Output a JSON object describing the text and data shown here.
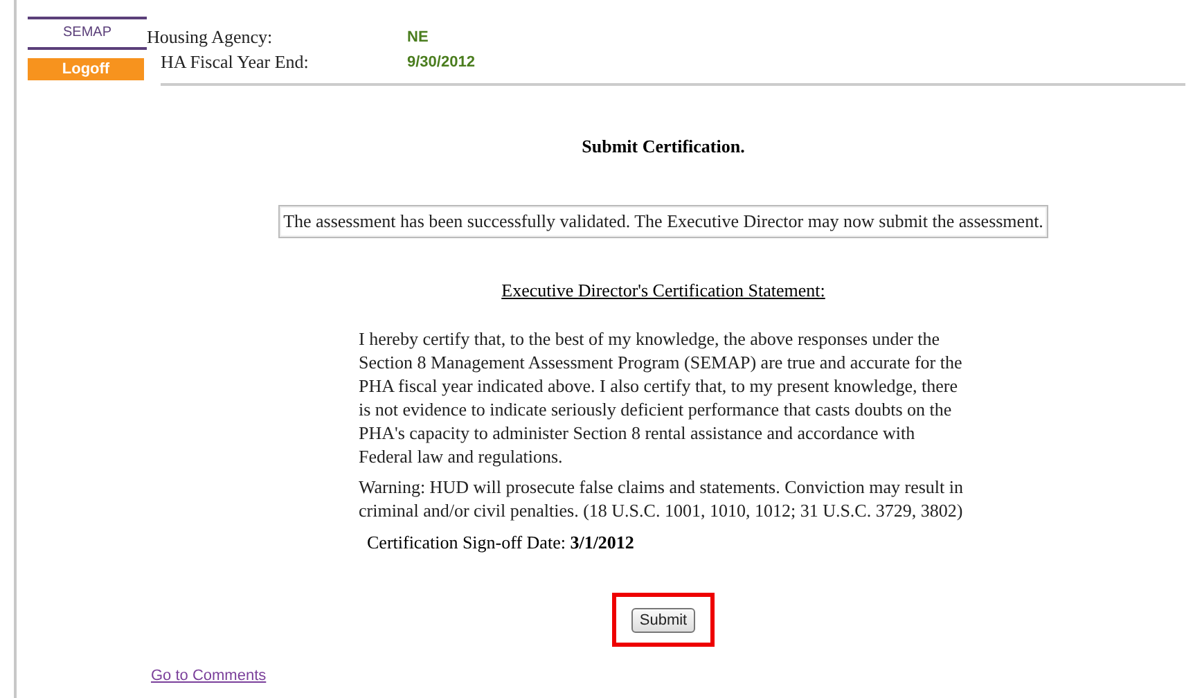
{
  "sidebar": {
    "items": [
      {
        "label": "SEMAP",
        "kind": "tab"
      },
      {
        "label": "Logoff",
        "kind": "button"
      }
    ]
  },
  "header_fields": [
    {
      "label": "Housing Agency:",
      "value": "NE"
    },
    {
      "label": "HA Fiscal Year End:",
      "value": "9/30/2012"
    }
  ],
  "title": "Submit Certification.",
  "message": "The assessment has been successfully validated. The Executive Director may now submit the assessment.",
  "statement": {
    "heading": "Executive Director's Certification Statement:",
    "paragraphs": [
      "I hereby certify that, to the best of my knowledge, the above responses under the Section 8 Management Assessment Program (SEMAP) are true and accurate for the PHA fiscal year indicated above. I also certify that, to my present knowledge, there is not evidence to indicate seriously deficient performance that casts doubts on the PHA's capacity to administer Section 8 rental assistance and accordance with Federal law and regulations.",
      "Warning: HUD will prosecute false claims and statements. Conviction may result in criminal and/or civil penalties. (18 U.S.C. 1001, 1010, 1012; 31 U.S.C. 3729, 3802)"
    ],
    "signoff_label": "Certification Sign-off Date:",
    "signoff_date": "3/1/2012"
  },
  "submit_button": {
    "label": "Submit",
    "highlighted": true
  },
  "link": "Go to Comments"
}
